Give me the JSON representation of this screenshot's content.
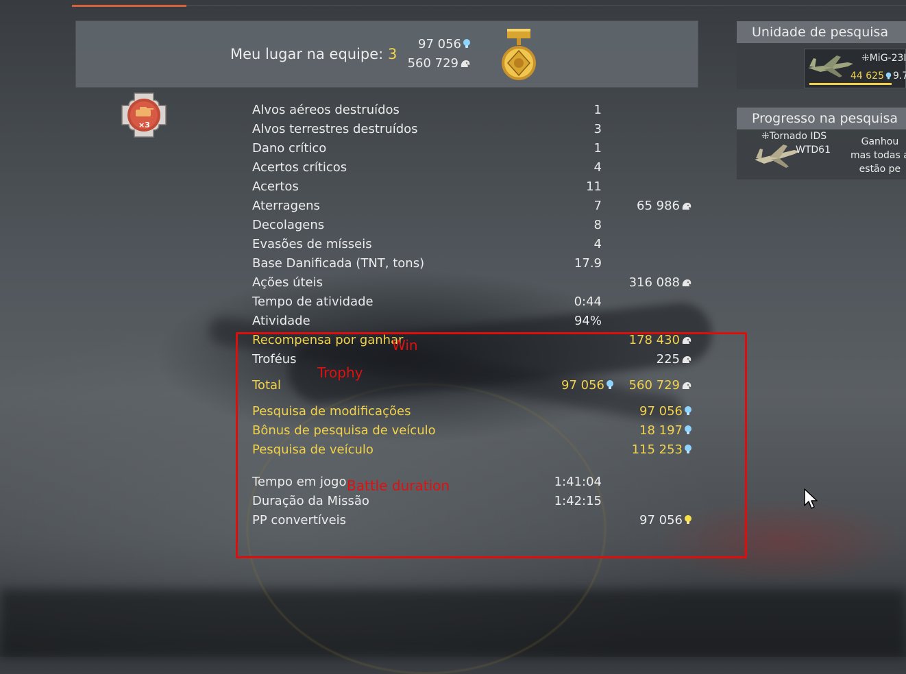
{
  "header": {
    "place_label": "Meu lugar na equipe: ",
    "place_value": "3",
    "research_points": "97 056",
    "silver_lions": "560 729"
  },
  "badge": {
    "multiplier": "×3"
  },
  "stats": [
    {
      "label": "Alvos aéreos destruídos",
      "count": "1",
      "reward": "",
      "style": "white"
    },
    {
      "label": "Alvos terrestres destruídos",
      "count": "3",
      "reward": "",
      "style": "white"
    },
    {
      "label": "Dano crítico",
      "count": "1",
      "reward": "",
      "style": "white"
    },
    {
      "label": "Acertos críticos",
      "count": "4",
      "reward": "",
      "style": "white"
    },
    {
      "label": "Acertos",
      "count": "11",
      "reward": "",
      "style": "white"
    },
    {
      "label": "Aterragens",
      "count": "7",
      "reward": "65 986",
      "reward_icon": "silver-lion-icon",
      "style": "white"
    },
    {
      "label": "Decolagens",
      "count": "8",
      "reward": "",
      "style": "white"
    },
    {
      "label": "Evasões de mísseis",
      "count": "4",
      "reward": "",
      "style": "white"
    },
    {
      "label": "Base Danificada (TNT, tons)",
      "count": "17.9",
      "reward": "",
      "style": "white"
    },
    {
      "label": "Ações úteis",
      "count": "",
      "reward": "316 088",
      "reward_icon": "silver-lion-icon",
      "style": "white"
    },
    {
      "label": "Tempo de atividade",
      "count": "0:44",
      "reward": "",
      "style": "white"
    },
    {
      "label": "Atividade",
      "count": "94%",
      "reward": "",
      "style": "white"
    },
    {
      "label": "Recompensa por ganhar",
      "count": "",
      "reward": "178 430",
      "reward_icon": "silver-lion-icon",
      "style": "gold"
    },
    {
      "label": "Troféus",
      "count": "",
      "reward": "225",
      "reward_icon": "silver-lion-icon",
      "style": "white"
    },
    {
      "label": "Total",
      "count": "97 056",
      "count_icon": "research-point-icon",
      "reward": "560 729",
      "reward_icon": "silver-lion-icon",
      "style": "gold"
    },
    {
      "label": "Pesquisa de modificações",
      "count": "",
      "reward": "97 056",
      "reward_icon": "research-point-icon",
      "style": "gold"
    },
    {
      "label": "Bônus de pesquisa de veículo",
      "count": "",
      "reward": "18 197",
      "reward_icon": "research-point-icon",
      "style": "gold"
    },
    {
      "label": "Pesquisa de veículo",
      "count": "",
      "reward": "115 253",
      "reward_icon": "research-point-icon",
      "style": "gold"
    },
    {
      "label": "Tempo em jogo",
      "count": "1:41:04",
      "reward": "",
      "style": "white"
    },
    {
      "label": "Duração da Missão",
      "count": "1:42:15",
      "reward": "",
      "style": "white"
    },
    {
      "label": "PP convertíveis",
      "count": "",
      "reward": "97 056",
      "reward_icon": "convertible-rp-icon",
      "style": "white"
    }
  ],
  "annotations": {
    "win": "Win",
    "trophy": "Trophy",
    "battle_duration": "Battle duration"
  },
  "research_unit": {
    "title": "Unidade de pesquisa",
    "vehicle_name": "⁜MiG-23I",
    "rp": "44 625",
    "br": "9.7"
  },
  "research_progress": {
    "title": "Progresso na pesquisa",
    "vehicle_name_line1": "⁜Tornado IDS",
    "vehicle_name_line2": "WTD61",
    "message_lines": [
      "Ganhou",
      "mas todas a",
      "estão pe"
    ]
  },
  "colors": {
    "gold": "#f2d24a",
    "text": "#ececec",
    "accent": "#d4633b",
    "annotation_red": "#e01010",
    "research_point_blue": "#8fd3ff"
  }
}
